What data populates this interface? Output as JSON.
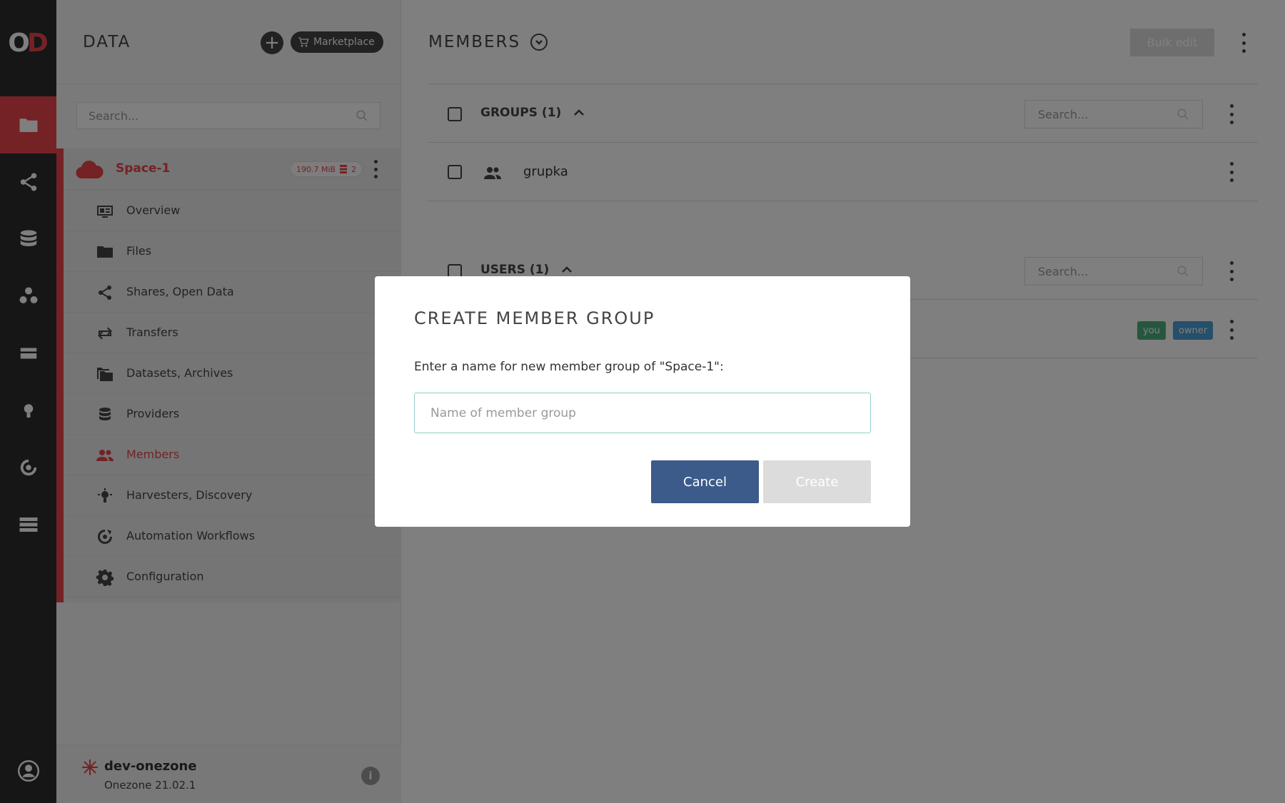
{
  "app": {
    "logo": {
      "left": "O",
      "right": "D"
    }
  },
  "rail": {
    "items": [
      {
        "icon": "folder-icon",
        "active": true
      },
      {
        "icon": "share-icon",
        "active": false
      },
      {
        "icon": "database-icon",
        "active": false
      },
      {
        "icon": "groups-icon",
        "active": false
      },
      {
        "icon": "tokens-icon",
        "active": false
      },
      {
        "icon": "harvester-icon",
        "active": false
      },
      {
        "icon": "workflow-icon",
        "active": false
      },
      {
        "icon": "clusters-icon",
        "active": false
      }
    ],
    "bottom_icon": "user-icon"
  },
  "sidebar": {
    "title": "DATA",
    "marketplace_label": "Marketplace",
    "search_placeholder": "Search...",
    "space": {
      "name": "Space-1",
      "size": "190.7 MiB",
      "providers_count": "2"
    },
    "items": [
      {
        "label": "Overview",
        "icon": "overview-icon",
        "active": false
      },
      {
        "label": "Files",
        "icon": "folder-icon",
        "active": false
      },
      {
        "label": "Shares, Open Data",
        "icon": "share-icon",
        "active": false
      },
      {
        "label": "Transfers",
        "icon": "transfers-icon",
        "active": false
      },
      {
        "label": "Datasets, Archives",
        "icon": "datasets-icon",
        "active": false
      },
      {
        "label": "Providers",
        "icon": "providers-icon",
        "active": false
      },
      {
        "label": "Members",
        "icon": "members-icon",
        "active": true
      },
      {
        "label": "Harvesters, Discovery",
        "icon": "harvester-icon",
        "active": false
      },
      {
        "label": "Automation Workflows",
        "icon": "workflow-icon",
        "active": false
      },
      {
        "label": "Configuration",
        "icon": "gear-icon",
        "active": false
      }
    ],
    "footer": {
      "zone_name": "dev-onezone",
      "version": "Onezone 21.02.1"
    }
  },
  "main": {
    "title": "MEMBERS",
    "bulk_edit_label": "Bulk edit",
    "groups": {
      "title": "GROUPS (1)",
      "search_placeholder": "Search...",
      "rows": [
        {
          "name": "grupka"
        }
      ]
    },
    "users": {
      "title": "USERS (1)",
      "search_placeholder": "Search...",
      "tags": {
        "you": "you",
        "owner": "owner"
      }
    }
  },
  "modal": {
    "title": "CREATE MEMBER GROUP",
    "text": "Enter a name for new member group of \"Space-1\":",
    "input_placeholder": "Name of member group",
    "cancel_label": "Cancel",
    "create_label": "Create"
  },
  "colors": {
    "accent": "#e8444b",
    "primary_button": "#3c5a8a",
    "disabled_button": "#dcdcdc",
    "tag_you": "#4caf7d",
    "tag_owner": "#4a9fd4"
  }
}
